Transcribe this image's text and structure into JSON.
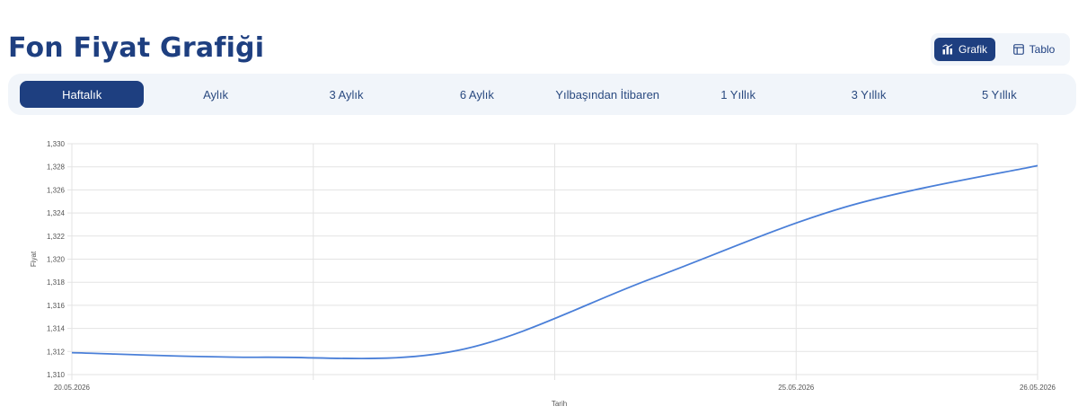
{
  "title": "Fon Fiyat Grafiği",
  "view_toggle": {
    "chart_label": "Grafik",
    "table_label": "Tablo"
  },
  "period_tabs": [
    "Haftalık",
    "Aylık",
    "3 Aylık",
    "6 Aylık",
    "Yılbaşından İtibaren",
    "1 Yıllık",
    "3 Yıllık",
    "5 Yıllık"
  ],
  "colors": {
    "brand": "#1e3f80",
    "line": "#4a7fd8",
    "panel": "#f1f5fa",
    "grid": "#e3e3e3"
  },
  "chart_data": {
    "type": "line",
    "xlabel": "Tarih",
    "ylabel": "Fiyat",
    "x_tick_labels": [
      "20.05.2026",
      "25.05.2026",
      "26.05.2026"
    ],
    "y_ticks": [
      "1,310",
      "1,312",
      "1,314",
      "1,316",
      "1,318",
      "1,320",
      "1,322",
      "1,324",
      "1,326",
      "1,328",
      "1,330"
    ],
    "ylim": [
      1.31,
      1.33
    ],
    "grid": true,
    "legend": "none",
    "series": [
      {
        "values": [
          1.3119,
          1.3115,
          1.3121,
          1.3183,
          1.3245,
          1.3281
        ]
      }
    ]
  }
}
